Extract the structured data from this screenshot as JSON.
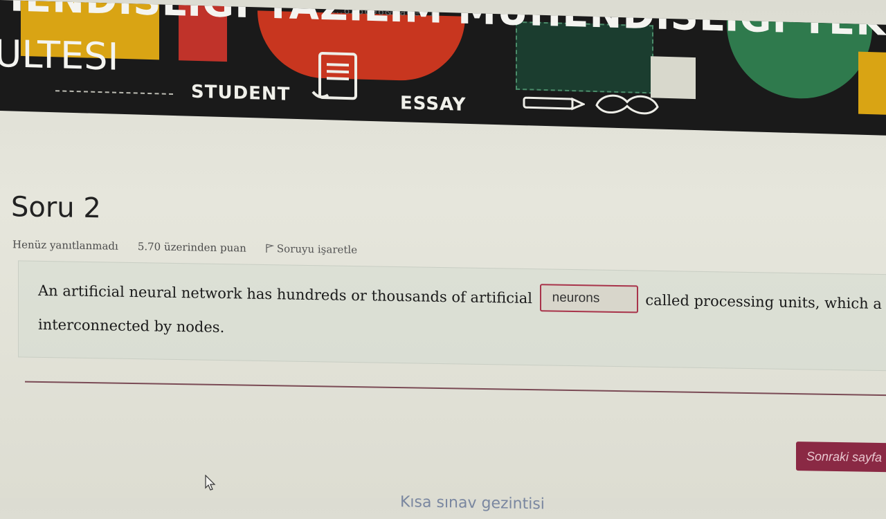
{
  "banner": {
    "url_fragment": "...626696&page=1",
    "title": "IENDISLIGI YAZILIM MUHENDISLIGI TEKNOLOJI",
    "subtitle": "ULTESI",
    "student_label": "STUDENT",
    "essay_label": "ESSAY"
  },
  "question": {
    "title": "Soru 2",
    "status": "Henüz yanıtlanmadı",
    "points": "5.70 üzerinden puan",
    "flag_label": "Soruyu işaretle",
    "text_before": "An artificial neural network has hundreds or thousands of artificial",
    "answer_value": "neurons",
    "text_after": "called processing units, which a",
    "text_line2": "interconnected by nodes."
  },
  "footer": {
    "next_button": "Sonraki sayfa",
    "quiz_nav": "Kısa sınav gezintisi"
  },
  "colors": {
    "accent": "#8a2944",
    "input_border": "#a8334a",
    "banner_bg": "#1a1a1a"
  }
}
